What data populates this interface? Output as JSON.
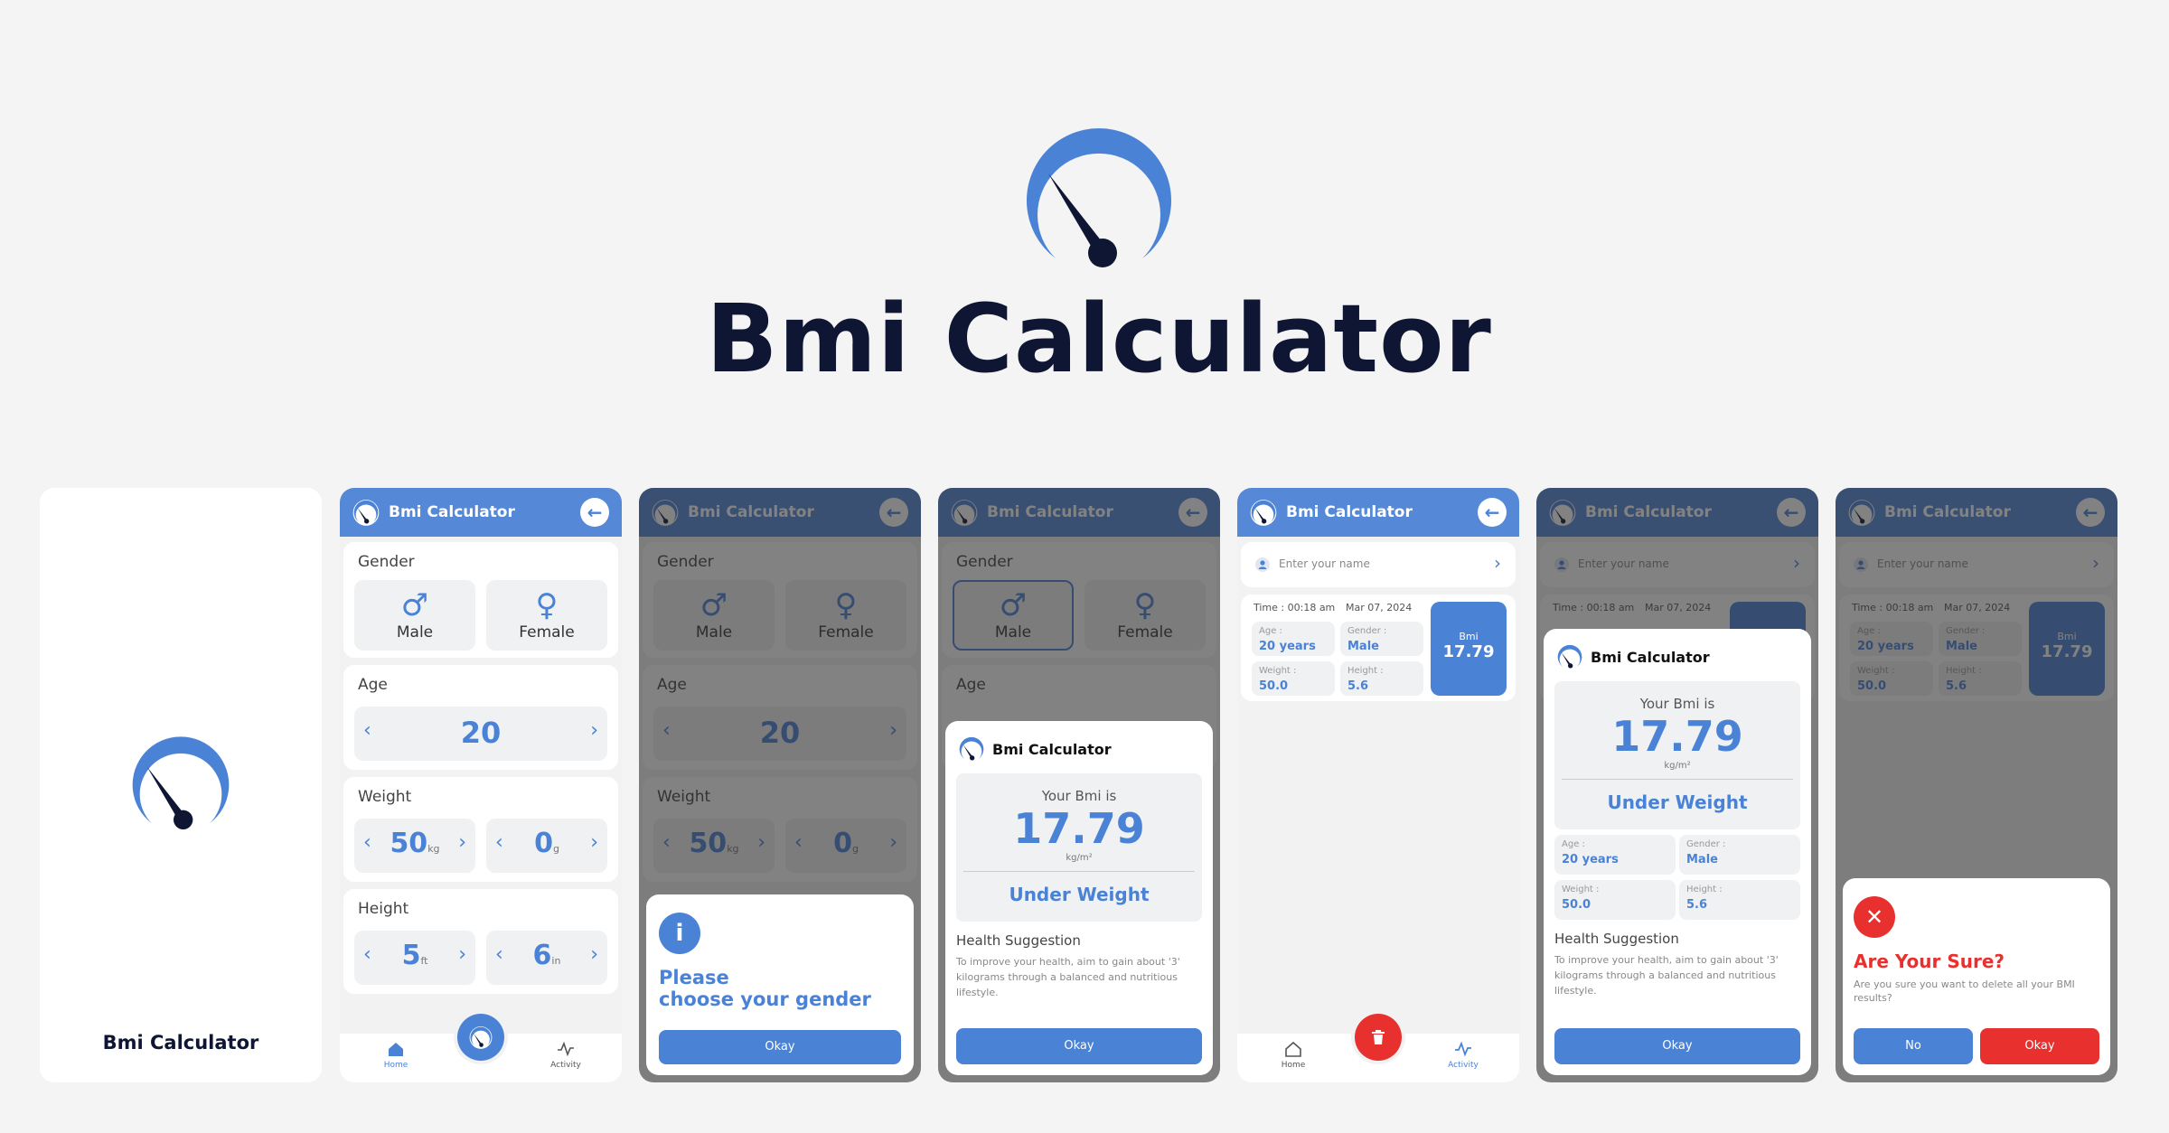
{
  "app_title": "Bmi Calculator",
  "back_glyph": "←",
  "colors": {
    "accent": "#4a82d6",
    "appbar": "#5589d8",
    "danger": "#e8302f",
    "dark": "#0e1633"
  },
  "icons": {
    "logo": "speedometer-logo",
    "back": "arrow-left",
    "male": "♂",
    "female": "♀",
    "info": "i",
    "close": "✕",
    "user": "user-icon",
    "delete": "trash-icon"
  },
  "form": {
    "gender_label": "Gender",
    "male": "Male",
    "female": "Female",
    "age_label": "Age",
    "age": "20",
    "weight_label": "Weight",
    "weight_kg": "50",
    "weight_kg_unit": "kg",
    "weight_g": "0",
    "weight_g_unit": "g",
    "height_label": "Height",
    "height_ft": "5",
    "height_ft_unit": "ft",
    "height_in": "6",
    "height_in_unit": "in"
  },
  "nav": {
    "home": "Home",
    "activity": "Activity"
  },
  "alert_gender": {
    "line1": "Please",
    "line2": "choose your gender",
    "ok": "Okay"
  },
  "result": {
    "your_bmi": "Your Bmi is",
    "bmi": "17.79",
    "unit": "kg/m²",
    "category": "Under Weight",
    "health_title": "Health Suggestion",
    "health_text": "To improve your health, aim to gain about '3' kilograms through a balanced and nutritious lifestyle.",
    "ok": "Okay"
  },
  "history": {
    "name_placeholder": "Enter your name",
    "time": "Time : 00:18 am",
    "date": "Mar 07, 2024",
    "age_key": "Age :",
    "age_val": "20 years",
    "gender_key": "Gender :",
    "gender_val": "Male",
    "weight_key": "Weight :",
    "weight_val": "50.0",
    "height_key": "Height :",
    "height_val": "5.6",
    "bmi_key": "Bmi",
    "bmi_val": "17.79"
  },
  "confirm": {
    "title": "Are Your Sure?",
    "text": "Are you sure you want to delete all your BMI results?",
    "no": "No",
    "ok": "Okay"
  }
}
